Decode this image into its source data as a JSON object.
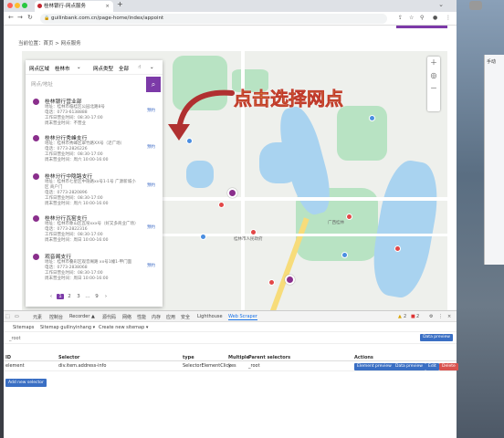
{
  "browser": {
    "tab_title": "桂林银行-网点服务",
    "url": "guilinbank.com.cn/page-home/index/appoint"
  },
  "page": {
    "breadcrumb": "当前位置：首页 > 网点服务",
    "filter": {
      "area_label": "网点区域",
      "area_value": "桂林市",
      "type_label": "网点类型",
      "type_value": "全部"
    },
    "search_placeholder": "网点/地址",
    "branches": [
      {
        "name": "桂林银行营业部",
        "address": "地址：桂林市临桂区公园北路8号",
        "phone": "电话：0773-6138888",
        "workday": "工作日营业时间：08:30-17:00",
        "weekend": "周末营业时间：不营业",
        "action": "预约"
      },
      {
        "name": "桂林分行秀峰支行",
        "address": "地址：桂林市秀峰区翠竹路XX号（近广场）",
        "phone": "电话：0773-2826226",
        "workday": "工作日营业时间：08:30-17:00",
        "weekend": "周末营业时间：周六 10:00-16:00",
        "action": "预约"
      },
      {
        "name": "桂林分行中隐路支行",
        "address": "地址：桂林市七星区中隐路xx号1-1号 广源新城小区 商户门",
        "phone": "电话：0773-2820896",
        "workday": "工作日营业时间：08:30-17:00",
        "weekend": "周末营业时间：周六 10:00-16:00",
        "action": "预约"
      },
      {
        "name": "桂林分行瓦窑支行",
        "address": "地址：桂林市象山区瓦窑xxx号（好又多商业广场）",
        "phone": "电话：0773-2822316",
        "workday": "工作日营业时间：08:30-17:00",
        "weekend": "周末营业时间：周日 10:00-16:00",
        "action": "预约"
      },
      {
        "name": "观音阁支行",
        "address": "地址：桂林市叠彩区观音阁路 xx号1幢1-甲门面",
        "phone": "电话：0773-2838068",
        "workday": "工作日营业时间：08:30-17:00",
        "weekend": "周末营业时间：周日 10:00-16:00",
        "action": "预约"
      }
    ],
    "pagination": [
      "‹",
      "1",
      "2",
      "3",
      "…",
      "9",
      "›"
    ],
    "callout": "点击选择网点",
    "map_labels": [
      "桂林市人民政府",
      "广西桂林"
    ]
  },
  "devtools": {
    "tabs": [
      "元素",
      "控制台",
      "Recorder ▲",
      "源代码",
      "网络",
      "性能",
      "内存",
      "应用",
      "安全",
      "Lighthouse",
      "Web Scraper"
    ],
    "errors": "2",
    "warnings": "2",
    "sub_menu": [
      "Sitemaps",
      "Sitemap guilinyinhang ▾",
      "Create new sitemap ▾"
    ],
    "path": "_root",
    "data_preview": "Data preview",
    "columns": [
      "ID",
      "Selector",
      "type",
      "Multiple",
      "Parent selectors",
      "Actions"
    ],
    "row": {
      "id": "element",
      "selector": "div.item.address-info",
      "type": "SelectorElementClick",
      "multiple": "yes",
      "parent": "_root"
    },
    "actions": [
      "Element preview",
      "Data preview",
      "Edit",
      "Delete"
    ],
    "add_selector": "Add new selector"
  },
  "colors": {
    "accent": "#7c3aa8",
    "link": "#3a68c4",
    "callout": "#f4e842",
    "arrow": "#b03030"
  }
}
